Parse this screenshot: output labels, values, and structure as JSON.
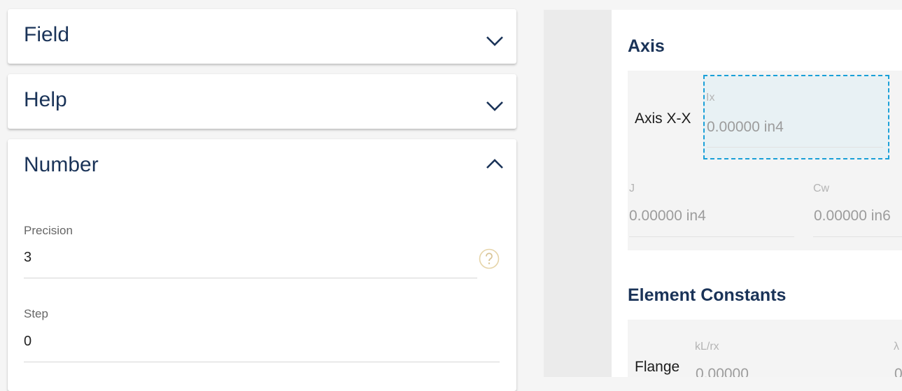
{
  "left": {
    "panels": [
      {
        "title": "Field",
        "expanded": false,
        "icon": "chevron-down-icon"
      },
      {
        "title": "Help",
        "expanded": false,
        "icon": "chevron-down-icon"
      },
      {
        "title": "Number",
        "expanded": true,
        "icon": "chevron-up-icon"
      }
    ],
    "number": {
      "precision_label": "Precision",
      "precision_value": "3",
      "step_label": "Step",
      "step_value": "0",
      "help_icon": "question-circle-icon"
    }
  },
  "right": {
    "axis": {
      "title": "Axis",
      "row_label": "Axis X-X",
      "ix_label": "Ix",
      "ix_value": "0.00000 in4",
      "j_label": "J",
      "j_value": "0.00000 in4",
      "cw_label": "Cw",
      "cw_value": "0.00000 in6"
    },
    "element_constants": {
      "title": "Element Constants",
      "row_label": "Flange",
      "kl_label": "kL/rx",
      "kl_value": "0.00000",
      "lambda_label": "λ",
      "lambda_value": "0"
    }
  },
  "colors": {
    "title": "#1a3358",
    "focus_border": "#1aa0d8",
    "focus_fill": "#e8f1f4"
  }
}
